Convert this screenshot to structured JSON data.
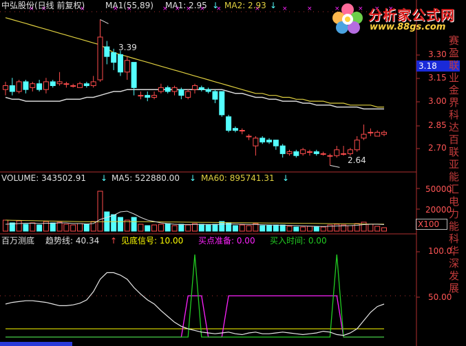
{
  "header": {
    "stock_name": "中弘股份(日线 前复权)",
    "ma_label": "MA1(55,89)",
    "ma1": "MA1: 2.95",
    "ma2": "MA2: 2.93",
    "arrow": "↓"
  },
  "logo": {
    "name": "分析家公式网",
    "url": "www.88gs.com"
  },
  "price_panel": {
    "ticks": [
      "3.30",
      "3.15",
      "3.00",
      "2.85",
      "2.70"
    ],
    "current_price": "3.18",
    "high_label": "3.39",
    "low_label": "2.64"
  },
  "volume_panel": {
    "volume": "VOLUME: 343502.91",
    "ma5": "MA5: 522880.00",
    "ma60": "MA60: 895741.31",
    "arrow": "↓",
    "ticks": [
      "50000",
      "20000"
    ],
    "multiplier": "X100"
  },
  "indicator_panel": {
    "name": "百万测底",
    "trend": "趋势线: 40.34",
    "bottom_signal": "见底信号: 10.00",
    "buy_prepare": "买点准备: 0.00",
    "buy_time": "买入时间: 0.00",
    "arrow": "↑",
    "ticks": [
      "100.0",
      "50.00"
    ]
  },
  "right_strip_text": "赛盈联业金界科达百联亚能汇电力能科华深发展",
  "colors": {
    "up": "#ff4d4d",
    "down": "#54ffff",
    "ma_white": "#d9d9d9",
    "ma_yellow": "#e0d040",
    "magenta": "#ff22ff",
    "green": "#22cc22",
    "cyan": "#54ffff",
    "yellow": "#ffff00"
  },
  "chart_data": {
    "type": "candlestick",
    "price_ylim": [
      2.62,
      3.42
    ],
    "candles": [
      {
        "o": 3.03,
        "c": 3.05,
        "h": 3.07,
        "l": 3.0
      },
      {
        "o": 3.05,
        "c": 3.02,
        "h": 3.09,
        "l": 3.0
      },
      {
        "o": 3.02,
        "c": 3.07,
        "h": 3.08,
        "l": 3.01
      },
      {
        "o": 3.07,
        "c": 3.03,
        "h": 3.08,
        "l": 3.01
      },
      {
        "o": 3.04,
        "c": 3.06,
        "h": 3.07,
        "l": 3.02
      },
      {
        "o": 3.06,
        "c": 3.03,
        "h": 3.08,
        "l": 3.02
      },
      {
        "o": 3.03,
        "c": 3.07,
        "h": 3.09,
        "l": 3.01
      },
      {
        "o": 3.07,
        "c": 3.05,
        "h": 3.08,
        "l": 3.04
      },
      {
        "o": 3.06,
        "c": 3.07,
        "h": 3.12,
        "l": 3.05
      },
      {
        "o": 3.06,
        "c": 3.06,
        "h": 3.07,
        "l": 3.04
      },
      {
        "o": 3.05,
        "c": 3.05,
        "h": 3.06,
        "l": 3.04
      },
      {
        "o": 3.04,
        "c": 3.06,
        "h": 3.07,
        "l": 3.04
      },
      {
        "o": 3.06,
        "c": 3.05,
        "h": 3.07,
        "l": 3.04
      },
      {
        "o": 3.05,
        "c": 3.07,
        "h": 3.1,
        "l": 3.04
      },
      {
        "o": 3.08,
        "c": 3.3,
        "h": 3.39,
        "l": 3.07
      },
      {
        "o": 3.25,
        "c": 3.2,
        "h": 3.28,
        "l": 3.16
      },
      {
        "o": 3.22,
        "c": 3.17,
        "h": 3.24,
        "l": 3.13
      },
      {
        "o": 3.21,
        "c": 3.12,
        "h": 3.23,
        "l": 3.1
      },
      {
        "o": 3.12,
        "c": 3.18,
        "h": 3.2,
        "l": 3.08
      },
      {
        "o": 3.17,
        "c": 3.04,
        "h": 3.17,
        "l": 3.0
      },
      {
        "o": 3.0,
        "c": 3.0,
        "h": 3.02,
        "l": 2.98
      },
      {
        "o": 3.0,
        "c": 2.99,
        "h": 3.02,
        "l": 2.97
      },
      {
        "o": 2.99,
        "c": 3.0,
        "h": 3.02,
        "l": 2.98
      },
      {
        "o": 3.02,
        "c": 3.04,
        "h": 3.06,
        "l": 3.01
      },
      {
        "o": 3.04,
        "c": 3.02,
        "h": 3.05,
        "l": 3.01
      },
      {
        "o": 3.02,
        "c": 3.04,
        "h": 3.05,
        "l": 3.0
      },
      {
        "o": 3.03,
        "c": 3.0,
        "h": 3.04,
        "l": 2.98
      },
      {
        "o": 2.99,
        "c": 3.02,
        "h": 3.03,
        "l": 2.98
      },
      {
        "o": 3.03,
        "c": 3.05,
        "h": 3.06,
        "l": 3.01
      },
      {
        "o": 3.04,
        "c": 3.03,
        "h": 3.05,
        "l": 3.02
      },
      {
        "o": 3.03,
        "c": 3.02,
        "h": 3.04,
        "l": 3.01
      },
      {
        "o": 3.02,
        "c": 2.98,
        "h": 3.03,
        "l": 2.96
      },
      {
        "o": 3.02,
        "c": 2.9,
        "h": 3.02,
        "l": 2.89
      },
      {
        "o": 2.89,
        "c": 2.82,
        "h": 2.9,
        "l": 2.81
      },
      {
        "o": 2.83,
        "c": 2.82,
        "h": 2.84,
        "l": 2.81
      },
      {
        "o": 2.82,
        "c": 2.82,
        "h": 2.83,
        "l": 2.8
      },
      {
        "o": 2.79,
        "c": 2.79,
        "h": 2.8,
        "l": 2.77
      },
      {
        "o": 2.74,
        "c": 2.78,
        "h": 2.79,
        "l": 2.69
      },
      {
        "o": 2.78,
        "c": 2.76,
        "h": 2.79,
        "l": 2.75
      },
      {
        "o": 2.77,
        "c": 2.76,
        "h": 2.78,
        "l": 2.75
      },
      {
        "o": 2.77,
        "c": 2.74,
        "h": 2.77,
        "l": 2.72
      },
      {
        "o": 2.74,
        "c": 2.7,
        "h": 2.75,
        "l": 2.68
      },
      {
        "o": 2.7,
        "c": 2.71,
        "h": 2.72,
        "l": 2.69
      },
      {
        "o": 2.71,
        "c": 2.69,
        "h": 2.72,
        "l": 2.68
      },
      {
        "o": 2.7,
        "c": 2.72,
        "h": 2.73,
        "l": 2.69
      },
      {
        "o": 2.71,
        "c": 2.71,
        "h": 2.72,
        "l": 2.69
      },
      {
        "o": 2.71,
        "c": 2.7,
        "h": 2.72,
        "l": 2.69
      },
      {
        "o": 2.7,
        "c": 2.7,
        "h": 2.71,
        "l": 2.69
      },
      {
        "o": 2.69,
        "c": 2.69,
        "h": 2.7,
        "l": 2.64
      },
      {
        "o": 2.69,
        "c": 2.72,
        "h": 2.74,
        "l": 2.68
      },
      {
        "o": 2.7,
        "c": 2.7,
        "h": 2.74,
        "l": 2.69
      },
      {
        "o": 2.7,
        "c": 2.72,
        "h": 2.73,
        "l": 2.69
      },
      {
        "o": 2.72,
        "c": 2.77,
        "h": 2.79,
        "l": 2.71
      },
      {
        "o": 2.78,
        "c": 2.8,
        "h": 2.85,
        "l": 2.77
      },
      {
        "o": 2.81,
        "c": 2.81,
        "h": 2.83,
        "l": 2.79
      },
      {
        "o": 2.79,
        "c": 2.81,
        "h": 2.82,
        "l": 2.79
      },
      {
        "o": 2.8,
        "c": 2.81,
        "h": 2.82,
        "l": 2.79
      }
    ],
    "ma_white": [
      2.99,
      2.98,
      2.98,
      2.97,
      2.97,
      2.97,
      2.97,
      2.97,
      2.97,
      2.98,
      2.98,
      2.98,
      2.99,
      2.99,
      3.0,
      3.01,
      3.02,
      3.02,
      3.03,
      3.03,
      3.03,
      3.03,
      3.03,
      3.03,
      3.03,
      3.03,
      3.03,
      3.03,
      3.03,
      3.03,
      3.03,
      3.03,
      3.03,
      3.02,
      3.01,
      3.01,
      3.0,
      2.99,
      2.99,
      2.98,
      2.98,
      2.97,
      2.97,
      2.97,
      2.96,
      2.96,
      2.95,
      2.95,
      2.95,
      2.94,
      2.94,
      2.94,
      2.94,
      2.93,
      2.93,
      2.93,
      2.93
    ],
    "ma_yellow": [
      3.4,
      3.39,
      3.38,
      3.37,
      3.36,
      3.35,
      3.34,
      3.33,
      3.32,
      3.31,
      3.3,
      3.29,
      3.28,
      3.27,
      3.26,
      3.24,
      3.22,
      3.21,
      3.2,
      3.19,
      3.18,
      3.17,
      3.16,
      3.15,
      3.14,
      3.13,
      3.12,
      3.11,
      3.1,
      3.09,
      3.08,
      3.07,
      3.06,
      3.05,
      3.04,
      3.03,
      3.02,
      3.01,
      3.01,
      3.0,
      3.0,
      2.99,
      2.99,
      2.98,
      2.98,
      2.97,
      2.97,
      2.97,
      2.96,
      2.96,
      2.96,
      2.95,
      2.95,
      2.95,
      2.95,
      2.94,
      2.94
    ],
    "volume_ylim": [
      0,
      70000
    ],
    "volume": [
      16000,
      12000,
      15000,
      10000,
      12000,
      9000,
      14000,
      12000,
      13000,
      10000,
      9000,
      11000,
      10000,
      14000,
      58000,
      28000,
      24000,
      20000,
      16000,
      20000,
      10000,
      8000,
      9000,
      10000,
      11000,
      8000,
      10000,
      9000,
      11000,
      10000,
      9000,
      10000,
      14000,
      12000,
      8000,
      9000,
      8000,
      11000,
      8000,
      8000,
      9000,
      9000,
      7000,
      6000,
      6000,
      7000,
      6000,
      6000,
      9000,
      10000,
      9000,
      8000,
      11000,
      13000,
      10000,
      7000,
      5000
    ],
    "vol_ma_white": [
      10000,
      10500,
      11000,
      11500,
      11500,
      11000,
      11500,
      11500,
      12000,
      12000,
      11000,
      11000,
      10500,
      11000,
      17000,
      20000,
      23000,
      28000,
      29000,
      25000,
      20000,
      16000,
      14000,
      12000,
      11000,
      10000,
      9500,
      9500,
      9800,
      9800,
      9700,
      9600,
      10000,
      10500,
      10200,
      10000,
      9800,
      9600,
      9300,
      9000,
      8800,
      8600,
      8400,
      8000,
      7500,
      7200,
      7000,
      6800,
      7000,
      7500,
      7800,
      8000,
      8500,
      9500,
      10000,
      10000,
      9500
    ],
    "vol_ma_yellow": [
      16000,
      15800,
      15600,
      15400,
      15200,
      15000,
      14800,
      14600,
      14400,
      14200,
      14000,
      13800,
      13600,
      13500,
      13600,
      13700,
      13800,
      13900,
      13900,
      13800,
      13700,
      13600,
      13500,
      13400,
      13300,
      13200,
      13100,
      13000,
      12900,
      12800,
      12700,
      12600,
      12500,
      12400,
      12300,
      12200,
      12100,
      12000,
      11900,
      11800,
      11700,
      11600,
      11500,
      11400,
      11300,
      11200,
      11100,
      11000,
      10900,
      10800,
      10700,
      10600,
      10500,
      10400,
      10300,
      10200,
      10100
    ],
    "ind_ylim": [
      -5,
      110
    ],
    "trend": [
      40,
      42,
      43,
      44,
      44,
      43,
      42,
      40,
      38,
      38,
      39,
      41,
      45,
      55,
      70,
      78,
      78,
      75,
      70,
      60,
      52,
      45,
      40,
      32,
      25,
      18,
      13,
      10,
      8,
      6,
      5,
      4,
      5,
      6,
      4,
      3,
      5,
      6,
      4,
      4,
      5,
      6,
      5,
      4,
      3,
      4,
      5,
      7,
      6,
      3,
      2,
      5,
      10,
      20,
      30,
      37,
      40
    ],
    "bottom_signal": [
      10,
      10,
      10,
      10,
      10,
      10,
      10,
      10,
      10,
      10,
      10,
      10,
      10,
      10,
      10,
      10,
      10,
      10,
      10,
      10,
      10,
      10,
      10,
      10,
      10,
      10,
      10,
      10,
      10,
      10,
      10,
      10,
      10,
      10,
      10,
      10,
      10,
      10,
      10,
      10,
      10,
      10,
      10,
      10,
      10,
      10,
      10,
      10,
      10,
      10,
      10,
      10,
      10,
      10,
      10,
      10,
      10
    ],
    "buy_prepare": [
      0,
      0,
      0,
      0,
      0,
      0,
      0,
      0,
      0,
      0,
      0,
      0,
      0,
      0,
      0,
      0,
      0,
      0,
      0,
      0,
      0,
      0,
      0,
      0,
      0,
      0,
      0,
      50,
      50,
      50,
      0,
      0,
      0,
      50,
      50,
      50,
      50,
      50,
      50,
      50,
      50,
      50,
      50,
      50,
      50,
      50,
      50,
      50,
      50,
      50,
      0,
      0,
      0,
      0,
      0,
      0,
      0
    ],
    "buy_time": [
      0,
      0,
      0,
      0,
      0,
      0,
      0,
      0,
      0,
      0,
      0,
      0,
      0,
      0,
      0,
      0,
      0,
      0,
      0,
      0,
      0,
      0,
      0,
      0,
      0,
      0,
      0,
      0,
      100,
      0,
      0,
      0,
      0,
      0,
      0,
      0,
      0,
      0,
      0,
      0,
      0,
      0,
      0,
      0,
      0,
      0,
      0,
      0,
      0,
      100,
      0,
      0,
      0,
      0,
      0,
      0,
      0
    ]
  }
}
